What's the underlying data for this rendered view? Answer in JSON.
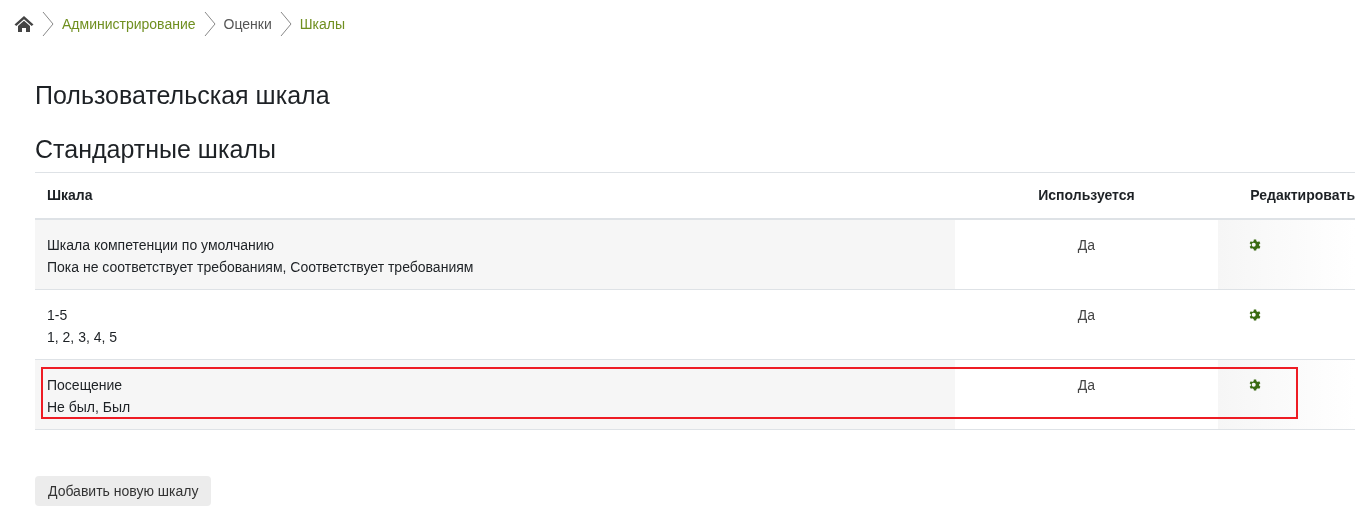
{
  "breadcrumb": [
    {
      "label": "Администрирование"
    },
    {
      "label": "Оценки"
    },
    {
      "label": "Шкалы"
    }
  ],
  "page_title": "Пользовательская шкала",
  "section_title": "Стандартные шкалы",
  "table": {
    "columns": [
      "Шкала",
      "Используется",
      "Редактировать"
    ],
    "rows": [
      {
        "name": "Шкала компетенции по умолчанию",
        "items": "Пока не соответствует требованиям, Соответствует требованиям",
        "used": "Да",
        "highlighted": false
      },
      {
        "name": "1-5",
        "items": "1, 2, 3, 4, 5",
        "used": "Да",
        "highlighted": false
      },
      {
        "name": "Посещение",
        "items": "Не был, Был",
        "used": "Да",
        "highlighted": true
      }
    ]
  },
  "add_button": "Добавить новую шкалу"
}
